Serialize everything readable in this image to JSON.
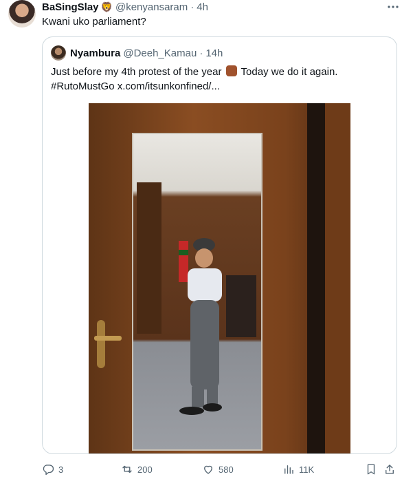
{
  "tweet": {
    "author_name": "BaSingSlay",
    "author_emoji": "🦁",
    "handle": "@kenyansaram",
    "separator": "·",
    "time": "4h",
    "text": "Kwani uko parliament?"
  },
  "quoted": {
    "author_name": "Nyambura",
    "handle": "@Deeh_Kamau",
    "separator": "·",
    "time": "14h",
    "text_part1": "Just before my 4th protest of the year",
    "text_part2": " Today we do it again.",
    "hashtag": "#RutoMustGo",
    "link": "x.com/itsunkonfined/..."
  },
  "actions": {
    "replies": "3",
    "reposts": "200",
    "likes": "580",
    "views": "11K"
  },
  "icons": [
    "more-icon",
    "reply-icon",
    "repost-icon",
    "like-icon",
    "views-icon",
    "bookmark-icon",
    "share-icon",
    "fist-emoji-icon",
    "lion-emoji-icon"
  ],
  "colors": {
    "text": "#0f1419",
    "muted": "#536471",
    "border": "#cfd9de",
    "link": "#0f1419"
  }
}
